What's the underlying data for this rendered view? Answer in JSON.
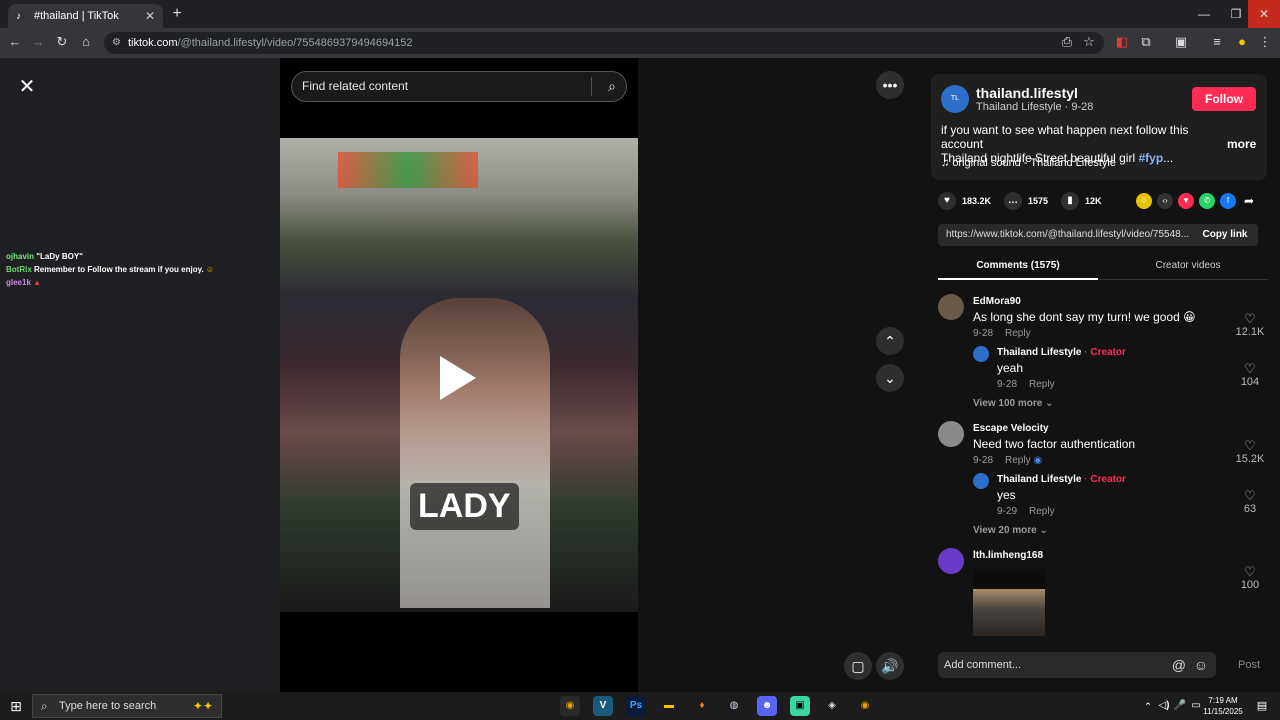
{
  "browser": {
    "tab_title": "#thailand | TikTok",
    "url_host": "tiktok.com",
    "url_path": "/@thailand.lifestyl/video/7554869379494694152"
  },
  "chat": [
    {
      "user": "ojhavin",
      "text": "\"LaDy BOY\"",
      "color": "#7be37b"
    },
    {
      "user": "BotRix",
      "text": "Remember to Follow the stream if you enjoy.",
      "color": "#6ad36a"
    },
    {
      "user": "glee1k",
      "text": "",
      "color": "#c98ae8"
    }
  ],
  "search": {
    "placeholder": "Find related content"
  },
  "video": {
    "caption": "LADY"
  },
  "author": {
    "name": "thailand.lifestyl",
    "display_name": "Thailand Lifestyle",
    "date": "9-28",
    "follow_label": "Follow",
    "description_line1": "if you want to see what happen next follow this account",
    "description_line2": "Thailand nightlife Street beautiful girl",
    "hashtag": "#fyp",
    "ellipsis": "...",
    "more_label": "more",
    "sound": "original sound - Thailand Lifestyle"
  },
  "stats": {
    "likes": "183.2K",
    "comments": "1575",
    "saves": "12K"
  },
  "link": {
    "url": "https://www.tiktok.com/@thailand.lifestyl/video/75548...",
    "copy_label": "Copy link"
  },
  "tabs": {
    "comments": "Comments (1575)",
    "creator_videos": "Creator videos"
  },
  "comments": [
    {
      "user": "EdMora90",
      "text": "As long she dont say my turn! we good 😀",
      "date": "9-28",
      "reply": "Reply",
      "likes": "12.1K",
      "creator_reply": {
        "user": "Thailand Lifestyle",
        "badge": "· Creator",
        "text": "yeah",
        "date": "9-28",
        "reply": "Reply",
        "likes": "104"
      },
      "view_more": "View 100 more"
    },
    {
      "user": "Escape Velocity",
      "text": "Need two factor authentication",
      "date": "9-28",
      "reply": "Reply",
      "likes": "15.2K",
      "creator_reply": {
        "user": "Thailand Lifestyle",
        "badge": "· Creator",
        "text": "yes",
        "date": "9-29",
        "reply": "Reply",
        "likes": "63"
      },
      "view_more": "View 20 more"
    },
    {
      "user": "lth.limheng168",
      "likes": "100"
    }
  ],
  "comment_input": {
    "placeholder": "Add comment...",
    "post_label": "Post"
  },
  "taskbar": {
    "search_placeholder": "Type here to search",
    "time": "7:19 AM",
    "date": "11/15/2025"
  },
  "colors": {
    "accent": "#fe2c55",
    "hashtag": "#8ab4f8"
  }
}
